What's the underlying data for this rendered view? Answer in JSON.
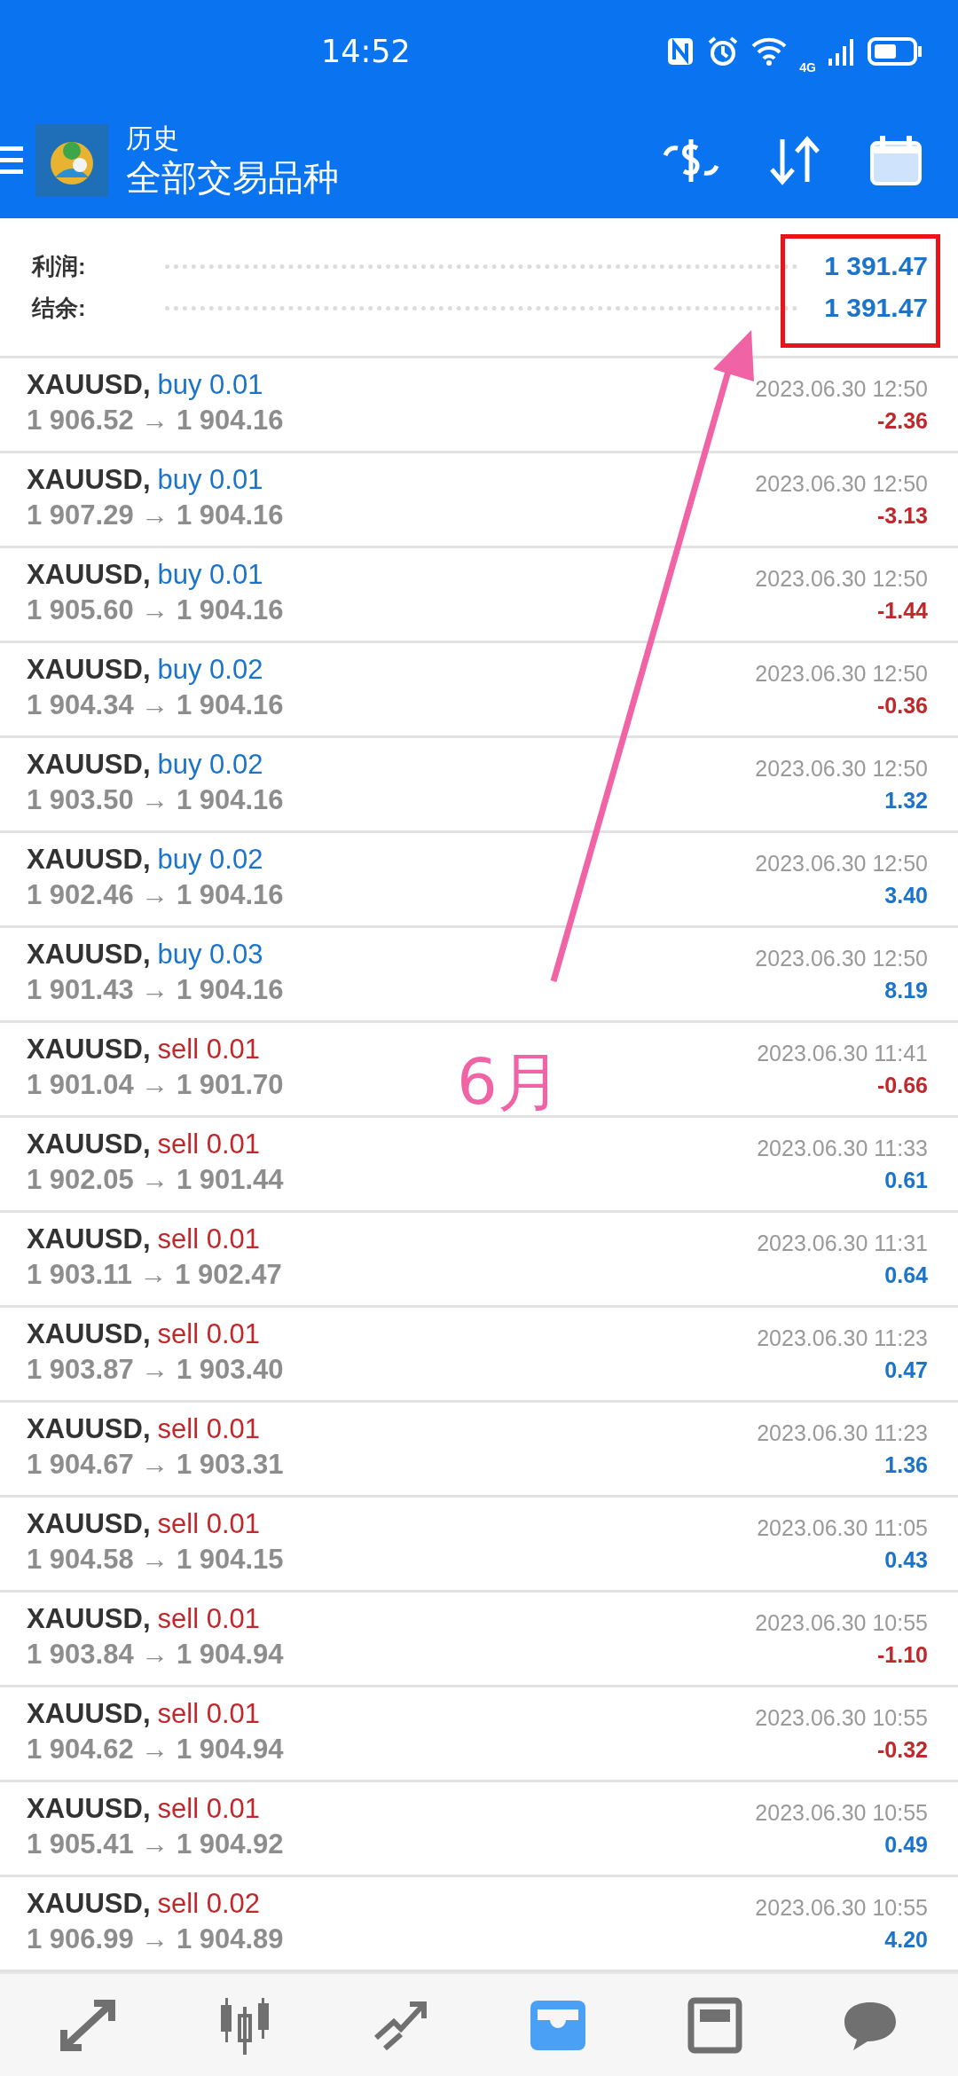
{
  "status_bar": {
    "time": "14:52",
    "network": "4G"
  },
  "app_bar": {
    "title": "历史",
    "subtitle": "全部交易品种"
  },
  "summary": [
    {
      "label": "利润:",
      "value": "1 391.47"
    },
    {
      "label": "结余:",
      "value": "1 391.47"
    }
  ],
  "deals": [
    {
      "symbol": "XAUUSD,",
      "sell": false,
      "type": "buy 0.01",
      "prices": "1 906.52 → 1 904.16",
      "time": "2023.06.30 12:50",
      "profit": "-2.36",
      "loss": true
    },
    {
      "symbol": "XAUUSD,",
      "sell": false,
      "type": "buy 0.01",
      "prices": "1 907.29 → 1 904.16",
      "time": "2023.06.30 12:50",
      "profit": "-3.13",
      "loss": true
    },
    {
      "symbol": "XAUUSD,",
      "sell": false,
      "type": "buy 0.01",
      "prices": "1 905.60 → 1 904.16",
      "time": "2023.06.30 12:50",
      "profit": "-1.44",
      "loss": true
    },
    {
      "symbol": "XAUUSD,",
      "sell": false,
      "type": "buy 0.02",
      "prices": "1 904.34 → 1 904.16",
      "time": "2023.06.30 12:50",
      "profit": "-0.36",
      "loss": true
    },
    {
      "symbol": "XAUUSD,",
      "sell": false,
      "type": "buy 0.02",
      "prices": "1 903.50 → 1 904.16",
      "time": "2023.06.30 12:50",
      "profit": "1.32",
      "loss": false
    },
    {
      "symbol": "XAUUSD,",
      "sell": false,
      "type": "buy 0.02",
      "prices": "1 902.46 → 1 904.16",
      "time": "2023.06.30 12:50",
      "profit": "3.40",
      "loss": false
    },
    {
      "symbol": "XAUUSD,",
      "sell": false,
      "type": "buy 0.03",
      "prices": "1 901.43 → 1 904.16",
      "time": "2023.06.30 12:50",
      "profit": "8.19",
      "loss": false
    },
    {
      "symbol": "XAUUSD,",
      "sell": true,
      "type": "sell 0.01",
      "prices": "1 901.04 → 1 901.70",
      "time": "2023.06.30 11:41",
      "profit": "-0.66",
      "loss": true
    },
    {
      "symbol": "XAUUSD,",
      "sell": true,
      "type": "sell 0.01",
      "prices": "1 902.05 → 1 901.44",
      "time": "2023.06.30 11:33",
      "profit": "0.61",
      "loss": false
    },
    {
      "symbol": "XAUUSD,",
      "sell": true,
      "type": "sell 0.01",
      "prices": "1 903.11 → 1 902.47",
      "time": "2023.06.30 11:31",
      "profit": "0.64",
      "loss": false
    },
    {
      "symbol": "XAUUSD,",
      "sell": true,
      "type": "sell 0.01",
      "prices": "1 903.87 → 1 903.40",
      "time": "2023.06.30 11:23",
      "profit": "0.47",
      "loss": false
    },
    {
      "symbol": "XAUUSD,",
      "sell": true,
      "type": "sell 0.01",
      "prices": "1 904.67 → 1 903.31",
      "time": "2023.06.30 11:23",
      "profit": "1.36",
      "loss": false
    },
    {
      "symbol": "XAUUSD,",
      "sell": true,
      "type": "sell 0.01",
      "prices": "1 904.58 → 1 904.15",
      "time": "2023.06.30 11:05",
      "profit": "0.43",
      "loss": false
    },
    {
      "symbol": "XAUUSD,",
      "sell": true,
      "type": "sell 0.01",
      "prices": "1 903.84 → 1 904.94",
      "time": "2023.06.30 10:55",
      "profit": "-1.10",
      "loss": true
    },
    {
      "symbol": "XAUUSD,",
      "sell": true,
      "type": "sell 0.01",
      "prices": "1 904.62 → 1 904.94",
      "time": "2023.06.30 10:55",
      "profit": "-0.32",
      "loss": true
    },
    {
      "symbol": "XAUUSD,",
      "sell": true,
      "type": "sell 0.01",
      "prices": "1 905.41 → 1 904.92",
      "time": "2023.06.30 10:55",
      "profit": "0.49",
      "loss": false
    },
    {
      "symbol": "XAUUSD,",
      "sell": true,
      "type": "sell 0.02",
      "prices": "1 906.99 → 1 904.89",
      "time": "2023.06.30 10:55",
      "profit": "4.20",
      "loss": false
    }
  ],
  "annotation": {
    "label": "6月"
  },
  "bottom_nav": [
    {
      "kind": "quotes",
      "selected": false
    },
    {
      "kind": "chart",
      "selected": false
    },
    {
      "kind": "trade",
      "selected": false
    },
    {
      "kind": "history",
      "selected": true
    },
    {
      "kind": "news",
      "selected": false
    },
    {
      "kind": "chat",
      "selected": false
    }
  ]
}
